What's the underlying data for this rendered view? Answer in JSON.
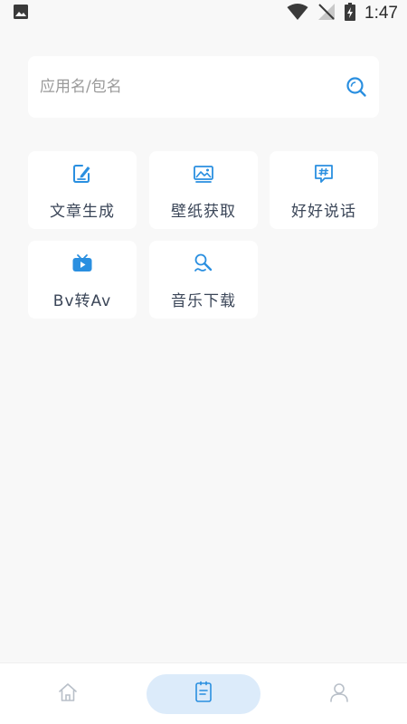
{
  "status_bar": {
    "time": "1:47",
    "icons": [
      "image-notification-icon",
      "wifi-icon",
      "no-signal-icon",
      "battery-charging-icon"
    ]
  },
  "search": {
    "placeholder": "应用名/包名",
    "value": ""
  },
  "tools": [
    {
      "label": "文章生成",
      "icon": "edit-document-icon"
    },
    {
      "label": "壁纸获取",
      "icon": "image-icon"
    },
    {
      "label": "好好说话",
      "icon": "hashtag-chat-icon"
    },
    {
      "label": "Bv转Av",
      "icon": "tv-play-icon"
    },
    {
      "label": "音乐下载",
      "icon": "music-search-icon"
    }
  ],
  "bottom_nav": {
    "items": [
      {
        "name": "home",
        "icon": "home-icon",
        "active": false
      },
      {
        "name": "tools",
        "icon": "note-icon",
        "active": true
      },
      {
        "name": "profile",
        "icon": "user-icon",
        "active": false
      }
    ]
  },
  "colors": {
    "accent": "#2a8fe0",
    "background": "#f8f8f8",
    "card": "#ffffff",
    "nav_active_bg": "#dcebfa",
    "nav_inactive": "#b8bfc8"
  }
}
